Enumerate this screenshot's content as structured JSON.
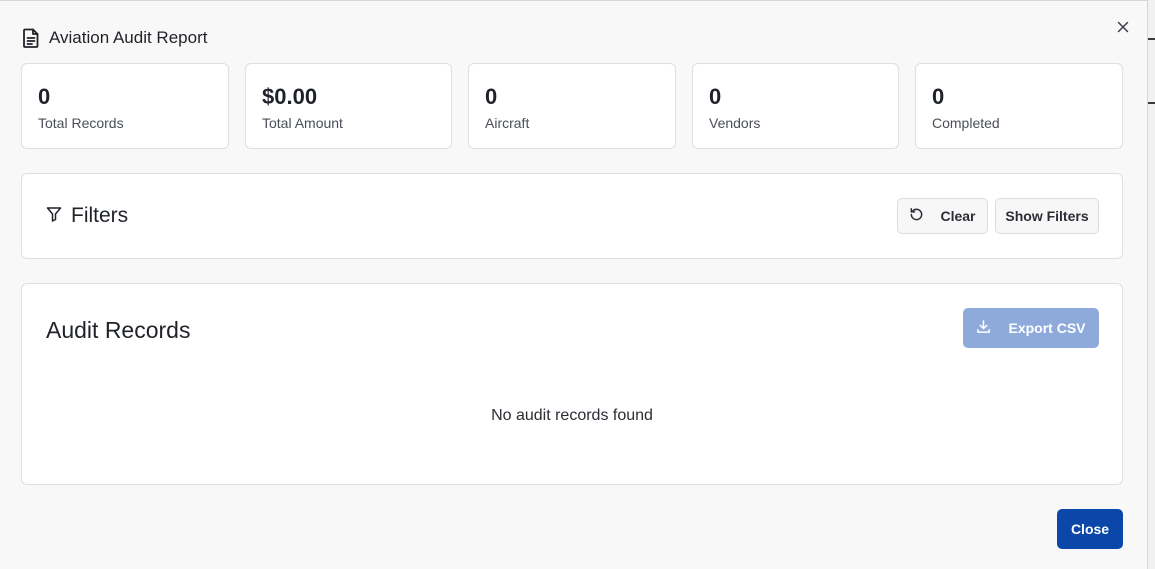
{
  "dialog": {
    "title": "Aviation Audit Report",
    "header_icon": "document-icon",
    "close_icon": "close-icon"
  },
  "stats": [
    {
      "value": "0",
      "label": "Total Records"
    },
    {
      "value": "$0.00",
      "label": "Total Amount"
    },
    {
      "value": "0",
      "label": "Aircraft"
    },
    {
      "value": "0",
      "label": "Vendors"
    },
    {
      "value": "0",
      "label": "Completed"
    }
  ],
  "filters": {
    "title": "Filters",
    "icon": "filter-icon",
    "clear_label": "Clear",
    "clear_icon": "reset-icon",
    "show_filters_label": "Show Filters"
  },
  "records": {
    "title": "Audit Records",
    "export_label": "Export CSV",
    "export_icon": "download-icon",
    "empty_message": "No audit records found"
  },
  "footer": {
    "close_label": "Close"
  },
  "colors": {
    "primary": "#0b47a8",
    "export_disabled": "#8eaadb",
    "background": "#f8f8f8",
    "card": "#ffffff"
  }
}
